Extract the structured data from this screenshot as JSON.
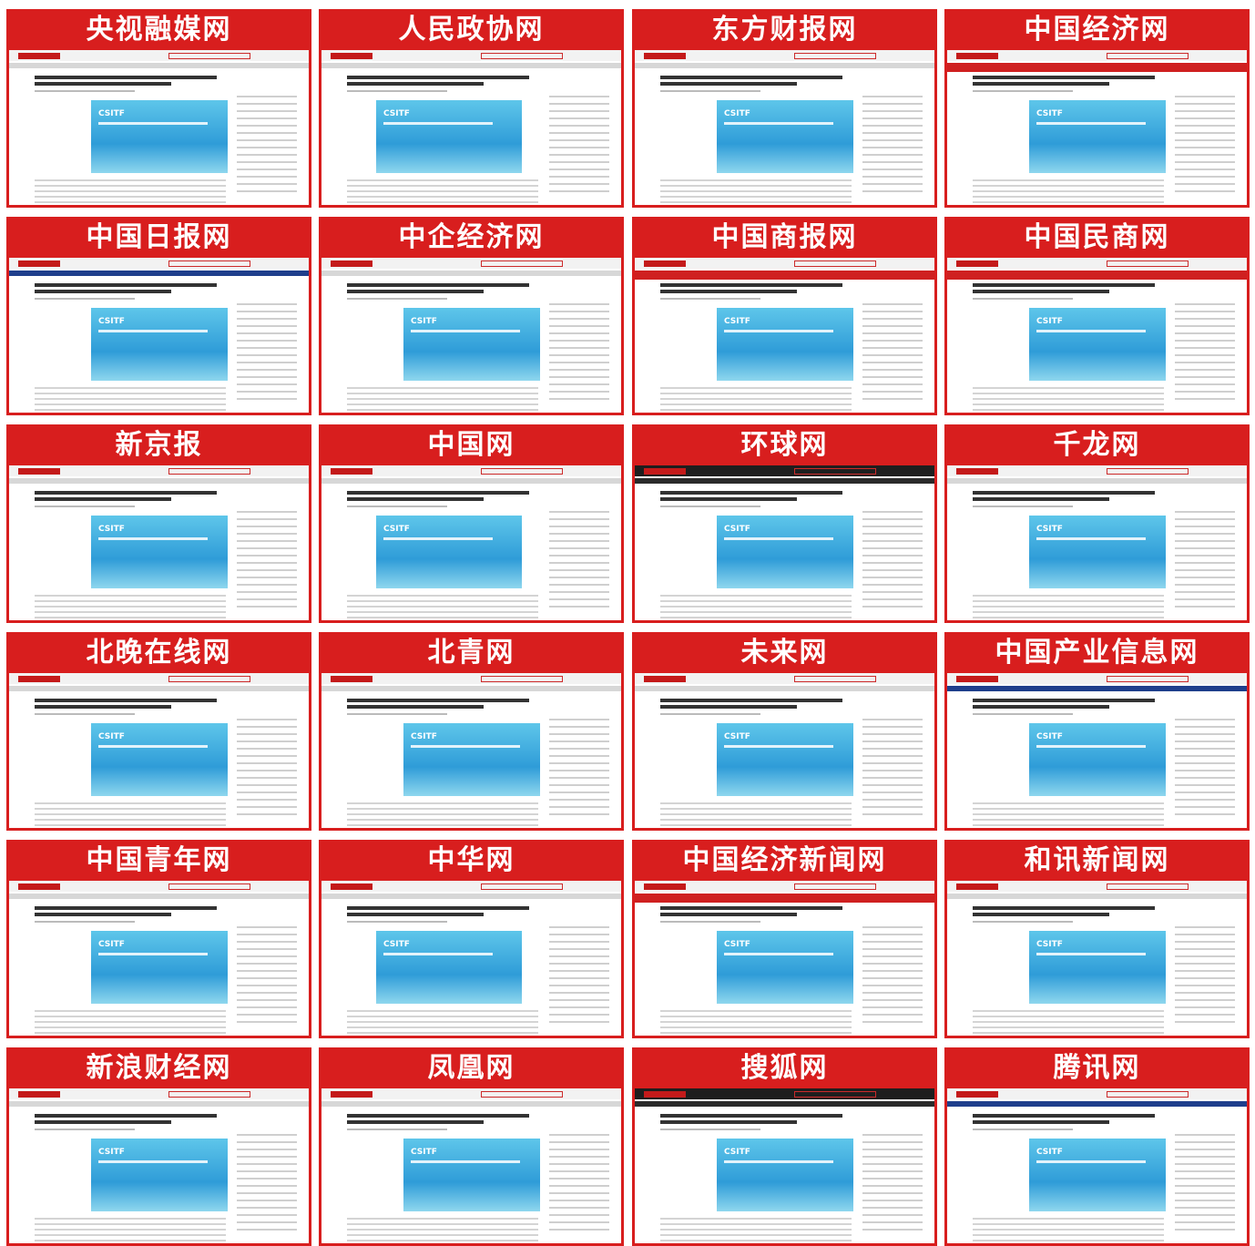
{
  "colors": {
    "card_red": "#d81e1e",
    "title_text": "#ffffff"
  },
  "article_image_tag": "CSITF",
  "cards": [
    {
      "title": "央视融媒网"
    },
    {
      "title": "人民政协网"
    },
    {
      "title": "东方财报网"
    },
    {
      "title": "中国经济网"
    },
    {
      "title": "中国日报网"
    },
    {
      "title": "中企经济网"
    },
    {
      "title": "中国商报网"
    },
    {
      "title": "中国民商网"
    },
    {
      "title": "新京报"
    },
    {
      "title": "中国网"
    },
    {
      "title": "环球网"
    },
    {
      "title": "千龙网"
    },
    {
      "title": "北晚在线网"
    },
    {
      "title": "北青网"
    },
    {
      "title": "未来网"
    },
    {
      "title": "中国产业信息网"
    },
    {
      "title": "中国青年网"
    },
    {
      "title": "中华网"
    },
    {
      "title": "中国经济新闻网"
    },
    {
      "title": "和讯新闻网"
    },
    {
      "title": "新浪财经网"
    },
    {
      "title": "凤凰网"
    },
    {
      "title": "搜狐网"
    },
    {
      "title": "腾讯网"
    }
  ]
}
